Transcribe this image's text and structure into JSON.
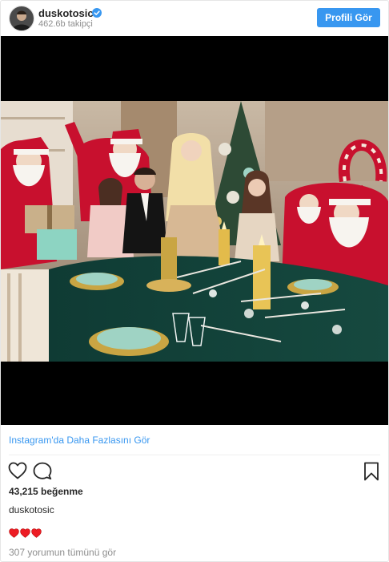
{
  "header": {
    "username": "duskotosic",
    "followers": "462.6b takipçi",
    "profile_button": "Profili Gör"
  },
  "post": {
    "more_link": "Instagram'da Daha Fazlasını Gör",
    "likes": "43,215 beğenme",
    "caption_user": "duskotosic",
    "caption_text": "❤❤❤",
    "comments_link": "307 yorumun tümünü gör"
  },
  "icons": {
    "verified": "verified-badge-icon",
    "like": "heart-outline-icon",
    "comment": "comment-bubble-icon",
    "save": "bookmark-icon"
  },
  "colors": {
    "accent": "#3897f0",
    "muted": "#8e8e8e",
    "text": "#262626",
    "heart": "#ed1c24"
  }
}
